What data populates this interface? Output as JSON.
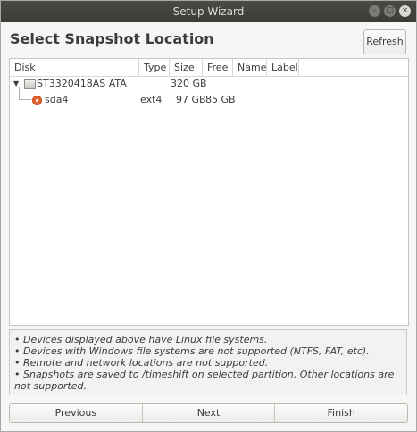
{
  "window": {
    "title": "Setup Wizard",
    "min_glyph": "–",
    "max_glyph": "□",
    "close_glyph": "×"
  },
  "header": {
    "title": "Select Snapshot Location",
    "refresh_label": "Refresh"
  },
  "table": {
    "columns": [
      "Disk",
      "Type",
      "Size",
      "Free",
      "Name",
      "Label"
    ],
    "rows": [
      {
        "disk": "ST3320418AS ATA",
        "type": "",
        "size": "320 GB",
        "free": "",
        "name": "",
        "label": "",
        "expanded": true,
        "icon": "hard-disk-icon"
      },
      {
        "disk": "sda4",
        "type": "ext4",
        "size": "97 GB",
        "free": "85 GB",
        "name": "",
        "label": "",
        "selected": true,
        "icon": "radio-selected-icon"
      }
    ]
  },
  "info": {
    "lines": [
      "• Devices displayed above have Linux file systems.",
      "• Devices with Windows file systems are not supported (NTFS, FAT, etc).",
      "• Remote and network locations are not supported.",
      "• Snapshots are saved to /timeshift on selected partition. Other locations are not supported."
    ]
  },
  "footer": {
    "previous_label": "Previous",
    "next_label": "Next",
    "finish_label": "Finish"
  },
  "colors": {
    "titlebar": "#3a3a37",
    "accent_radio": "#e2622c"
  }
}
